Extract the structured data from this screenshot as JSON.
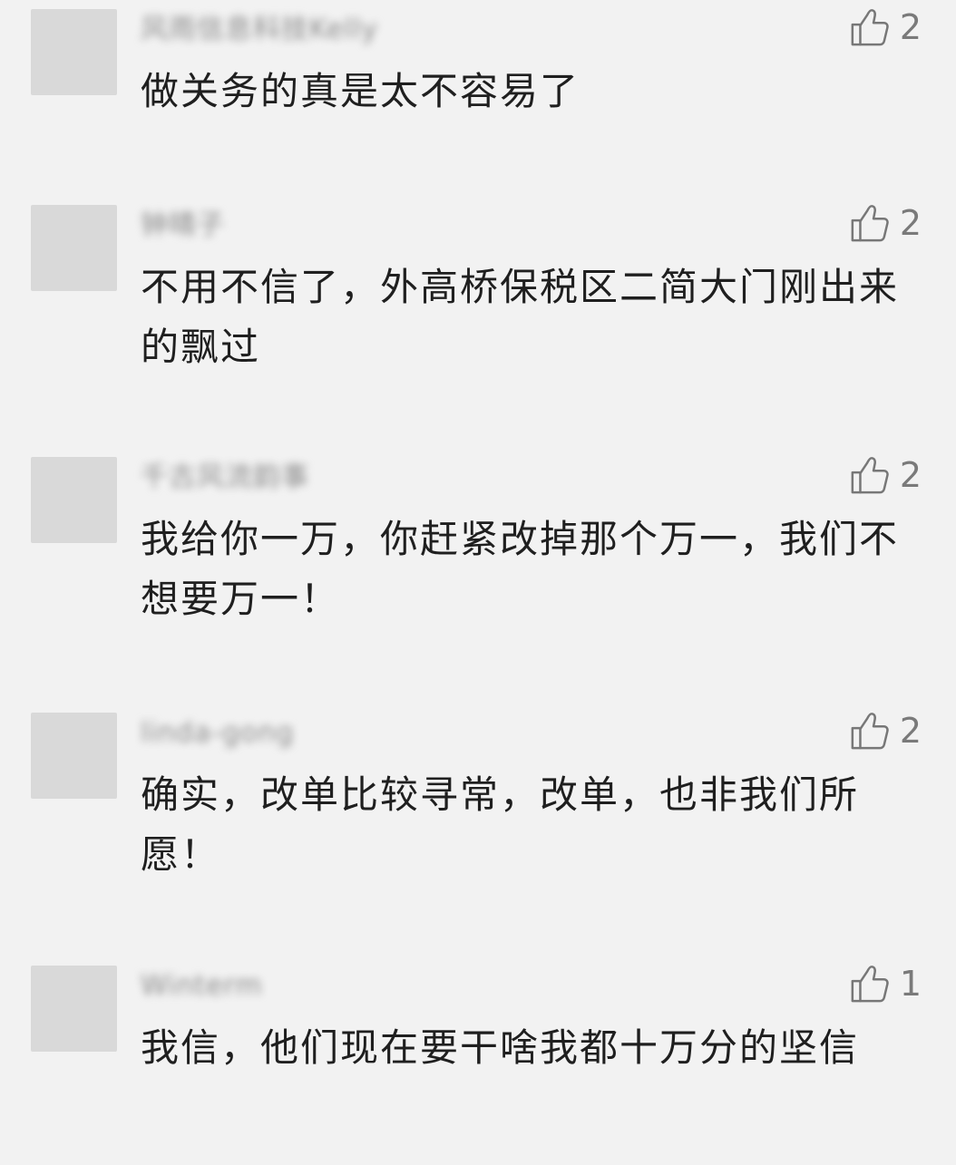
{
  "comments": [
    {
      "nickname": "风雨信息科技Kelly",
      "likes": "2",
      "text": "做关务的真是太不容易了"
    },
    {
      "nickname": "钟晴子",
      "likes": "2",
      "text": "不用不信了，外高桥保税区二简大门刚出来的飘过"
    },
    {
      "nickname": "千古风流韵事",
      "likes": "2",
      "text": "我给你一万，你赶紧改掉那个万一，我们不想要万一！"
    },
    {
      "nickname": "linda-gong",
      "likes": "2",
      "text": "确实，改单比较寻常，改单，也非我们所愿！"
    },
    {
      "nickname": "Winterm",
      "likes": "1",
      "text": "我信，他们现在要干啥我都十万分的坚信"
    }
  ],
  "icons": {
    "like": "thumbs-up-icon"
  },
  "colors": {
    "background": "#f2f2f2",
    "avatar_placeholder": "#d9d9d9",
    "text": "#1f1f1f",
    "muted": "#7a7a7a"
  }
}
